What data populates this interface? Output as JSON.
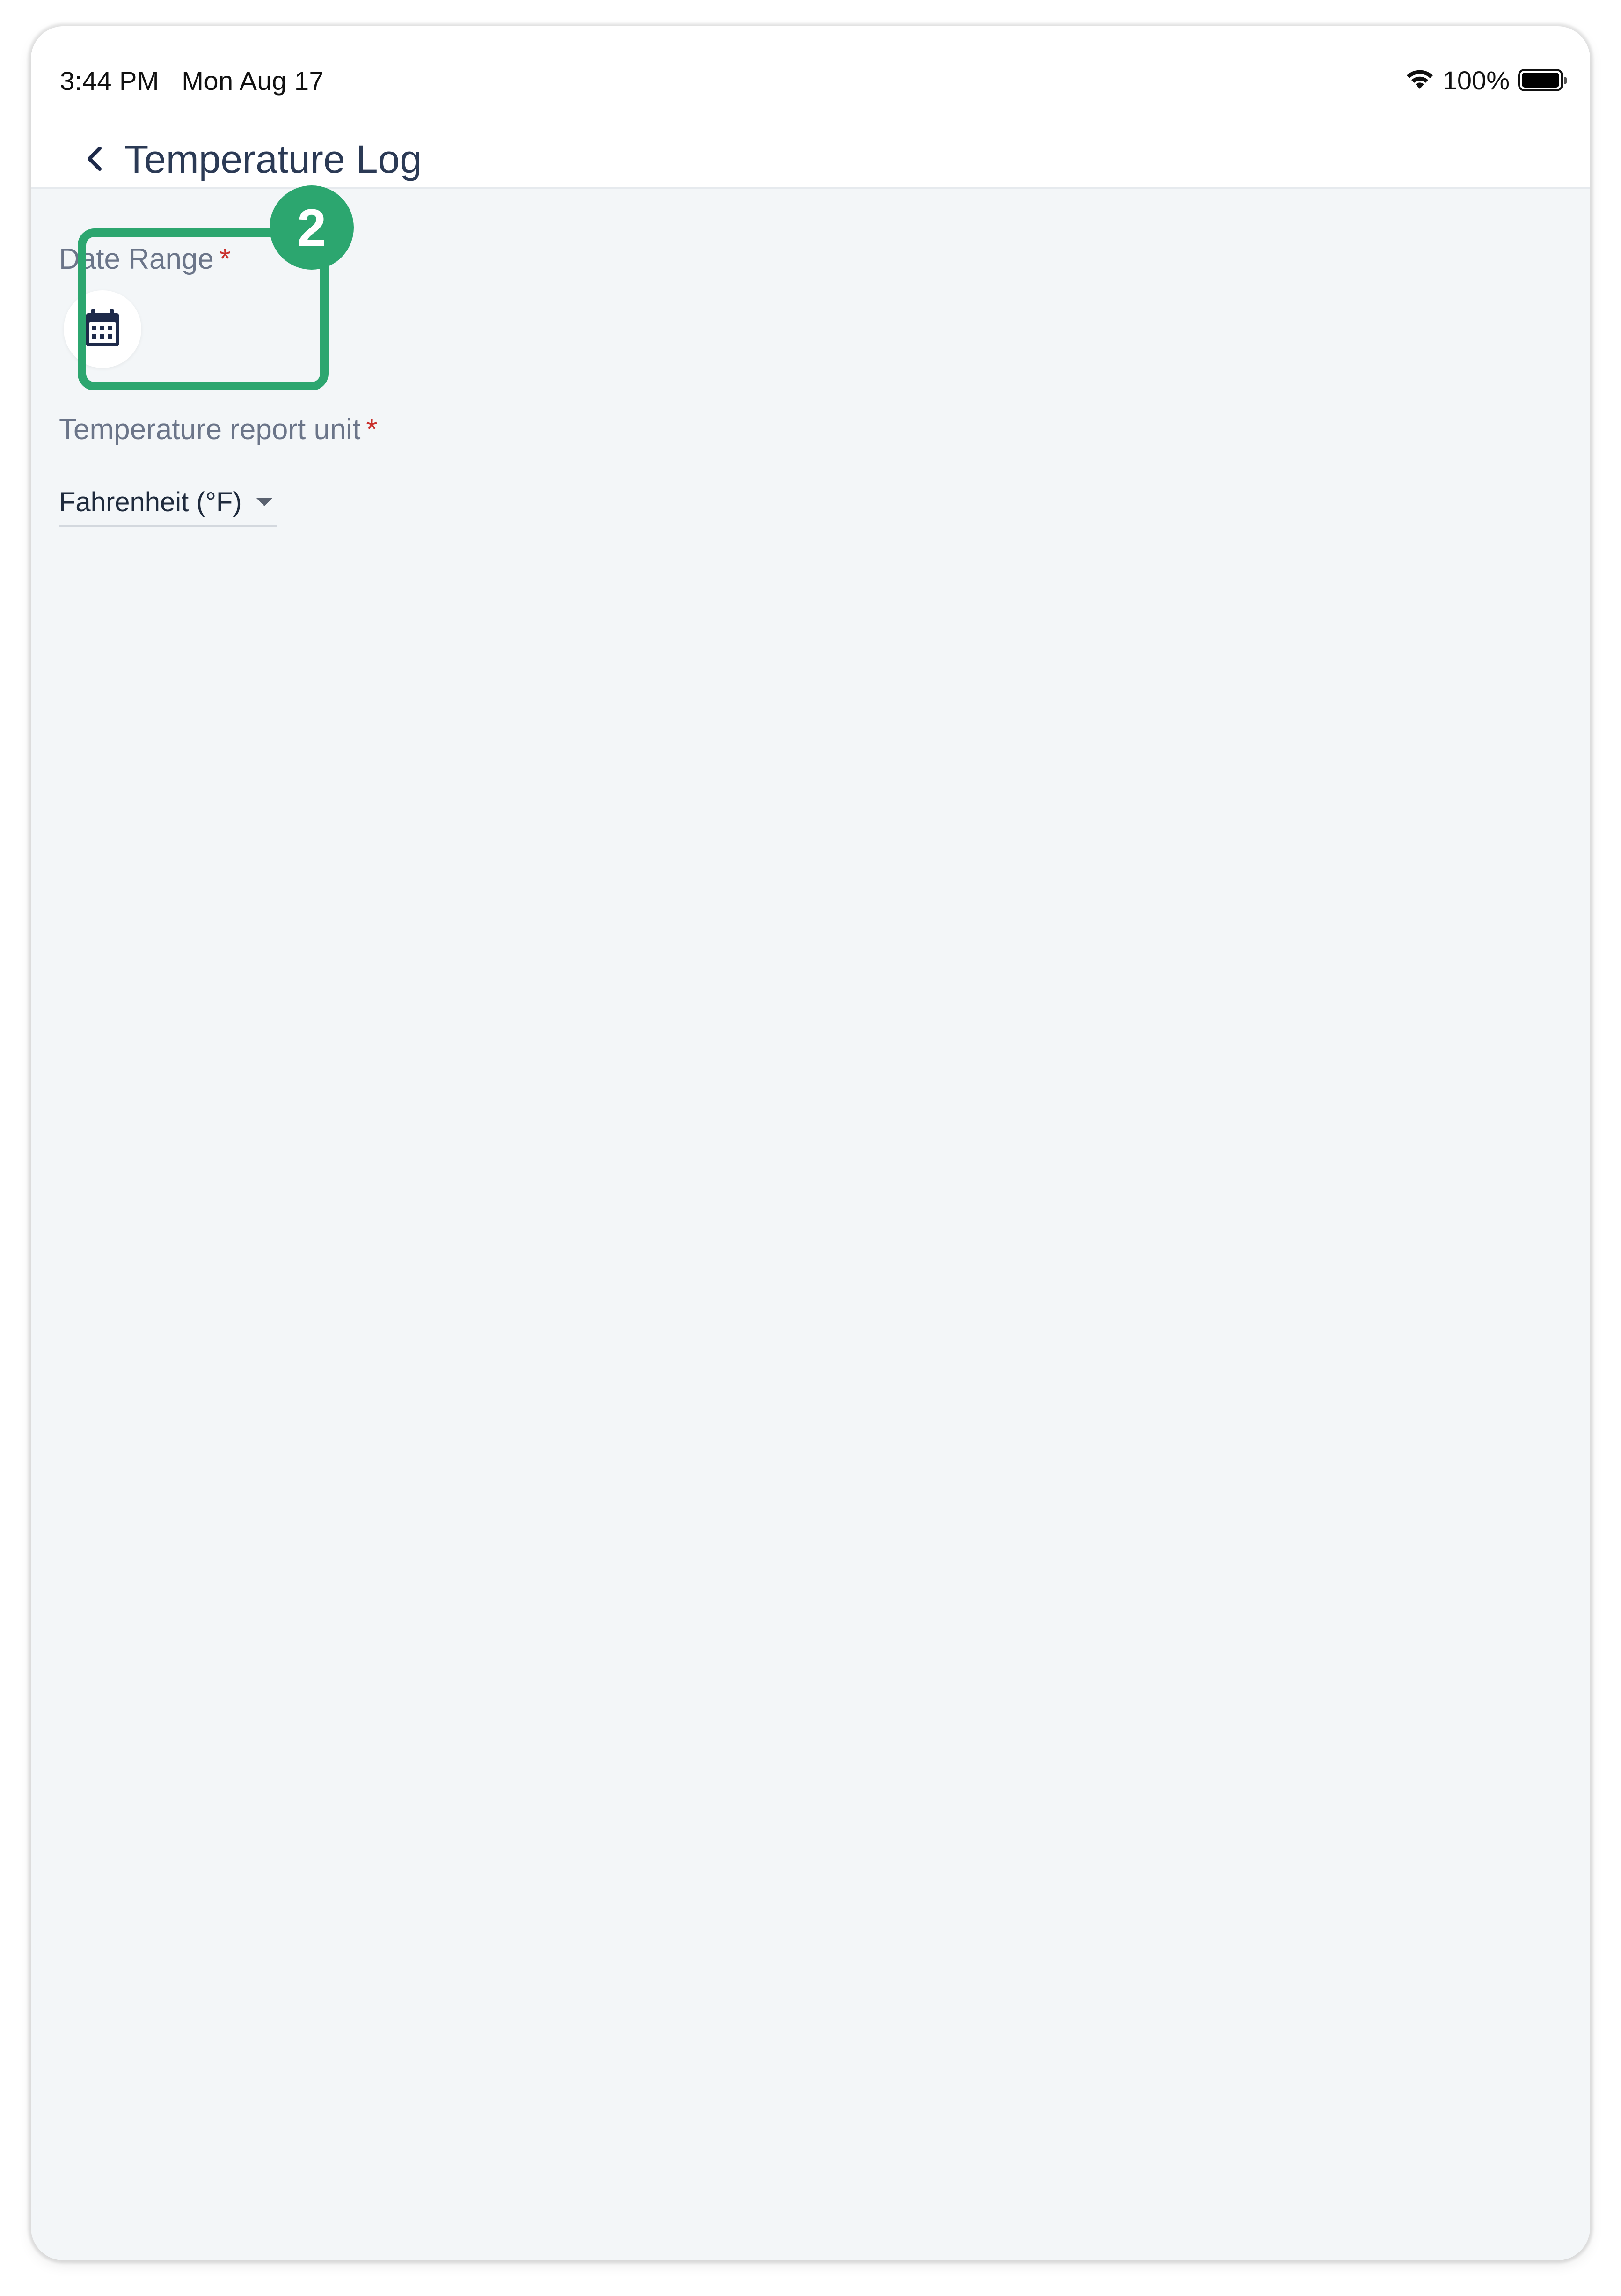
{
  "status_bar": {
    "time": "3:44 PM   Mon Aug 17",
    "battery_percent": "100%",
    "wifi_icon": "wifi-icon",
    "battery_icon": "battery-full-icon"
  },
  "header": {
    "back_icon": "chevron-left-icon",
    "title": "Temperature Log"
  },
  "form": {
    "date_range": {
      "label": "Date Range",
      "required_mark": "*",
      "icon": "calendar-icon"
    },
    "temperature_unit": {
      "label": "Temperature report unit",
      "required_mark": "*",
      "selected_value": "Fahrenheit (°F)"
    }
  },
  "tutorial": {
    "step_number": "2",
    "highlight_color": "#2ca66f"
  },
  "colors": {
    "title": "#2b3a55",
    "label": "#6b7589",
    "required": "#c9302c",
    "background": "#f3f6f8",
    "calendar_icon": "#1e2a4a"
  }
}
